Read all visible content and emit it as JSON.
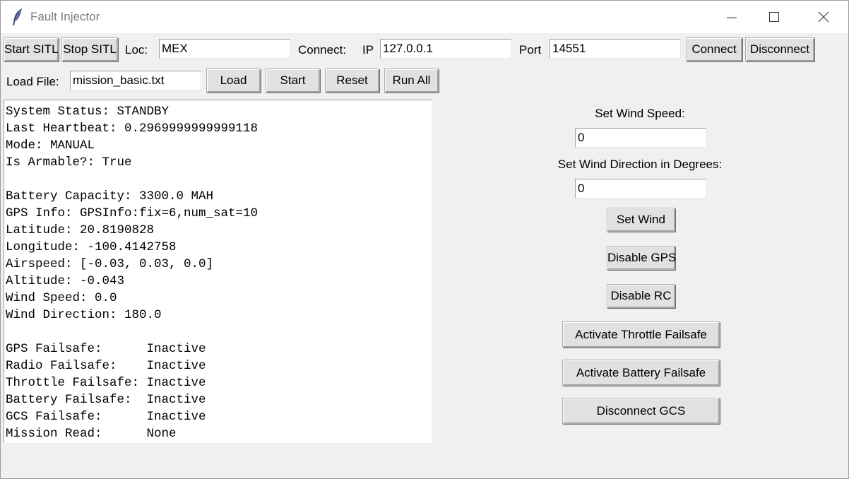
{
  "window": {
    "title": "Fault Injector",
    "icon": "feather-icon",
    "controls": [
      "minimize-icon",
      "maximize-icon",
      "close-icon"
    ]
  },
  "toolbar": {
    "start_sitl": "Start SITL",
    "stop_sitl": "Stop SITL",
    "loc_label": "Loc:",
    "loc_value": "MEX",
    "connect_label": "Connect:",
    "ip_label": "IP",
    "ip_value": "127.0.0.1",
    "port_label": "Port",
    "port_value": "14551",
    "connect_button": "Connect",
    "disconnect_button": "Disconnect"
  },
  "file_bar": {
    "load_file_label": "Load File:",
    "file_value": "mission_basic.txt",
    "load_button": "Load",
    "start_button": "Start",
    "reset_button": "Reset",
    "run_all_button": "Run All"
  },
  "status_lines": [
    "System Status: STANDBY",
    "Last Heartbeat: 0.2969999999999118",
    "Mode: MANUAL",
    "Is Armable?: True",
    "",
    "Battery Capacity: 3300.0 MAH",
    "GPS Info: GPSInfo:fix=6,num_sat=10",
    "Latitude: 20.8190828",
    "Longitude: -100.4142758",
    "Airspeed: [-0.03, 0.03, 0.0]",
    "Altitude: -0.043",
    "Wind Speed: 0.0",
    "Wind Direction: 180.0",
    "",
    "GPS Failsafe:      Inactive",
    "Radio Failsafe:    Inactive",
    "Throttle Failsafe: Inactive",
    "Battery Failsafe:  Inactive",
    "GCS Failsafe:      Inactive",
    "Mission Read:      None"
  ],
  "controls": {
    "wind_speed_label": "Set Wind Speed:",
    "wind_speed_value": "0",
    "wind_direction_label": "Set Wind Direction in Degrees:",
    "wind_direction_value": "0",
    "set_wind": "Set Wind",
    "disable_gps": "Disable GPS",
    "disable_rc": "Disable RC",
    "throttle_failsafe": "Activate Throttle Failsafe",
    "battery_failsafe": "Activate Battery Failsafe",
    "disconnect_gcs": "Disconnect GCS"
  }
}
